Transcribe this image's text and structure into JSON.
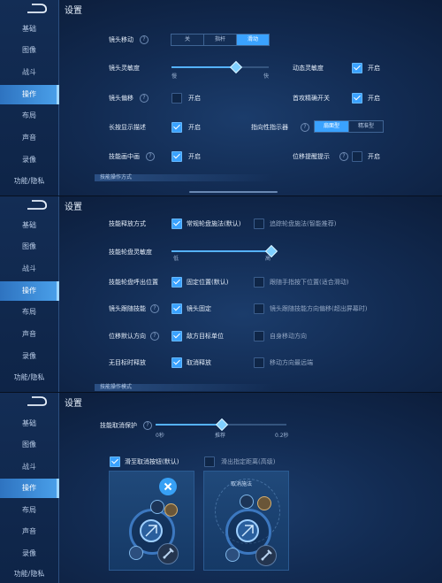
{
  "sidebar": {
    "items": [
      "基础",
      "图像",
      "战斗",
      "操作",
      "布局",
      "声音",
      "录像",
      "功能/隐私"
    ],
    "active": "操作"
  },
  "page_title": "设置",
  "panel1": {
    "camera_move": {
      "label": "镜头移动",
      "options": [
        "关",
        "指杆",
        "滑动"
      ],
      "selected": "滑动"
    },
    "camera_sensitivity": {
      "label": "镜头灵敏度",
      "min_label": "慢",
      "max_label": "快",
      "value": 0.6
    },
    "dynamic_sensitivity": {
      "label": "动态灵敏度",
      "state": "开启",
      "checked": true
    },
    "camera_offset": {
      "label": "镜头偏移",
      "state": "开启",
      "checked": false
    },
    "first_precision": {
      "label": "首攻精确开关",
      "state": "开启",
      "checked": true
    },
    "long_press_desc": {
      "label": "长按显示描述",
      "state": "开启",
      "checked": true
    },
    "indicator": {
      "label": "指向性指示器",
      "options": [
        "扇面型",
        "精准型"
      ],
      "selected": "扇面型"
    },
    "skill_draw": {
      "label": "技能画中画",
      "state": "开启",
      "checked": true
    },
    "displacement_tip": {
      "label": "位移提醒提示",
      "state": "开启",
      "checked": false
    },
    "section": "技能操作方式"
  },
  "panel2": {
    "cast_mode": {
      "label": "技能释放方式",
      "option1": "常规轮盘施法(默认)",
      "option1_checked": true,
      "option2": "追踪轮盘施法(智能推荐)",
      "option2_checked": false
    },
    "wheel_sensitivity": {
      "label": "技能轮盘灵敏度",
      "min_label": "低",
      "max_label": "高",
      "value": 1.0
    },
    "wheel_position": {
      "label": "技能轮盘呼出位置",
      "option1": "固定位置(默认)",
      "option1_checked": true,
      "option2": "跟随手指按下位置(适合滑动)",
      "option2_checked": false
    },
    "camera_follow": {
      "label": "镜头跟随技能",
      "option1": "镜头固定",
      "option1_checked": true,
      "option2": "镜头跟随技能方向偏移(超出屏幕时)",
      "option2_checked": false
    },
    "default_direction": {
      "label": "位移默认方向",
      "option1": "敌方目标单位",
      "option1_checked": true,
      "option2": "自身移动方向",
      "option2_checked": false
    },
    "no_target": {
      "label": "无目标时释放",
      "option1": "取消释放",
      "option1_checked": true,
      "option2": "移动方向最远端",
      "option2_checked": false
    },
    "section": "技能操作模式"
  },
  "panel3": {
    "cancel_protect": {
      "label": "技能取消保护",
      "ticks": [
        "0秒",
        "推荐",
        "0.2秒"
      ],
      "value": 0.5
    },
    "option1": {
      "label": "滑至取消按钮(默认)",
      "checked": true
    },
    "option2": {
      "label": "滑出指定距离(高级)",
      "checked": false
    },
    "card2_caption": "取消施法"
  },
  "colors": {
    "accent": "#3aa2ff",
    "active_tab": "#4aa0ea",
    "background": "#122b52"
  }
}
